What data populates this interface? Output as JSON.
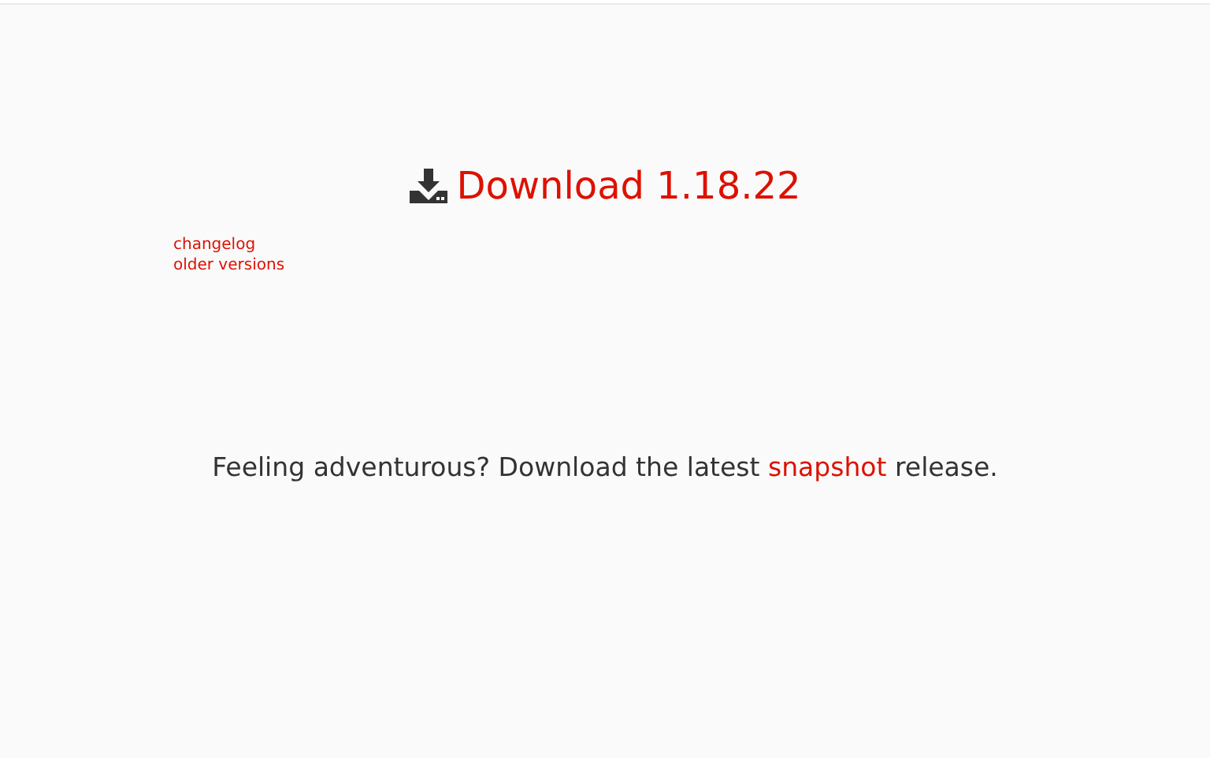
{
  "download": {
    "label": "Download 1.18.22"
  },
  "links": [
    "changelog",
    "older versions"
  ],
  "snapshot": {
    "before": "Feeling adventurous? Download the latest ",
    "link": "snapshot",
    "after": " release."
  }
}
